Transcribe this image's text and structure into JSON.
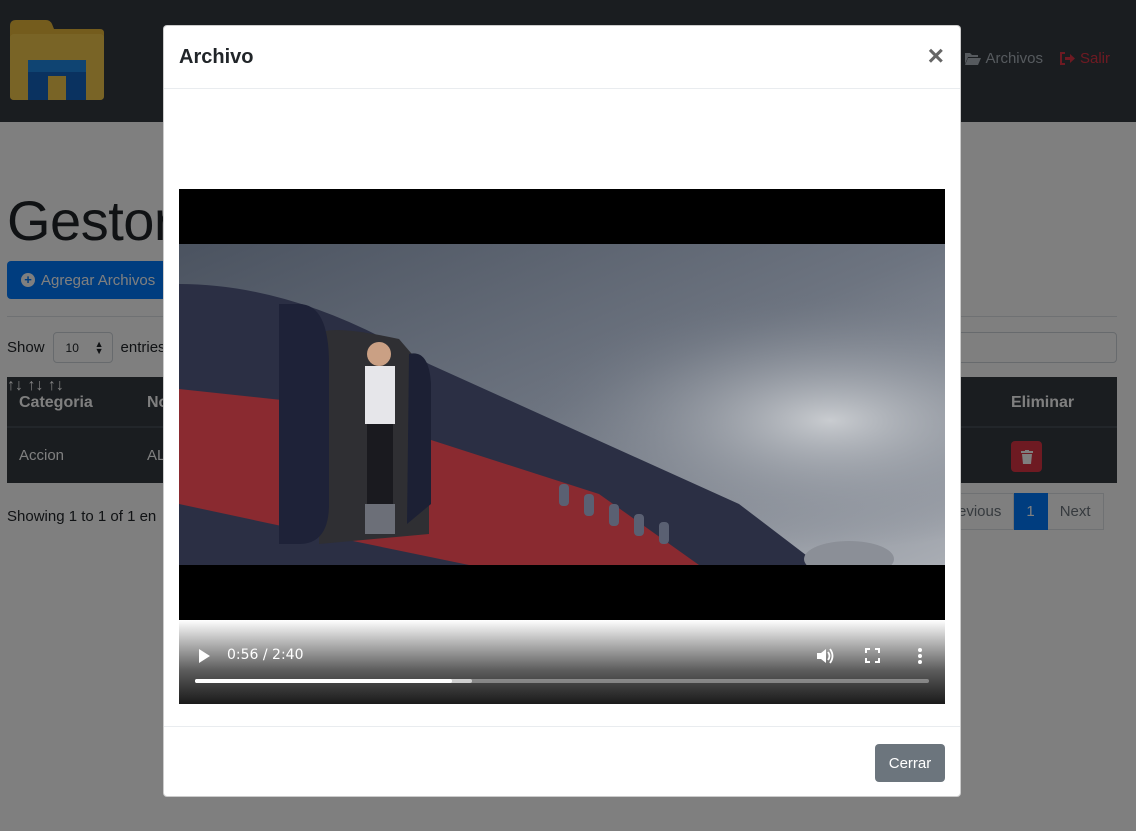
{
  "navbar": {
    "links": [
      {
        "icon": "folder-open-icon",
        "label": "Archivos"
      },
      {
        "icon": "sign-out-icon",
        "label": "Salir"
      }
    ]
  },
  "page": {
    "title": "Gestor",
    "add_button": "Agregar Archivos",
    "show_label": "Show",
    "show_value": "10",
    "entries_label": "entries",
    "info": "Showing 1 to 1 of 1 en"
  },
  "table": {
    "headers": [
      "Categoria",
      "No",
      "Eliminar"
    ],
    "rows": [
      {
        "categoria": "Accion",
        "nombre": "AL"
      }
    ]
  },
  "pagination": {
    "previous": "revious",
    "current": "1",
    "next": "Next"
  },
  "modal": {
    "title": "Archivo",
    "close_symbol": "×",
    "video": {
      "time": "0:56 / 2:40",
      "progress": 0.35,
      "buffered": 0.377
    },
    "footer_button": "Cerrar"
  },
  "colors": {
    "navbar": "#343a40",
    "primary": "#007bff",
    "danger": "#dc3545",
    "secondary": "#6c757d"
  }
}
